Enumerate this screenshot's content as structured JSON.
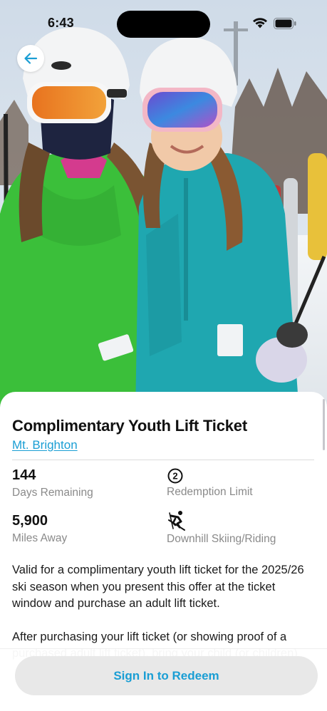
{
  "status_bar": {
    "time": "6:43"
  },
  "hero": {
    "image_subject": "two-skiers-photo"
  },
  "navigation": {
    "back_icon": "arrow-left-icon"
  },
  "offer": {
    "title": "Complimentary Youth Lift Ticket",
    "resort": "Mt. Brighton",
    "stats": [
      {
        "value": "144",
        "label": "Days Remaining"
      },
      {
        "icon": "redemption-count-icon",
        "icon_text": "2",
        "label": "Redemption Limit"
      },
      {
        "value": "5,900",
        "label": "Miles Away"
      },
      {
        "icon": "skier-icon",
        "label": "Downhill Skiing/Riding"
      }
    ],
    "description": [
      "Valid for a complimentary youth lift ticket for the 2025/26 ski season when you present this offer at the ticket window and purchase an adult lift ticket.",
      "After purchasing your lift ticket (or showing proof of a purchased adult lift ticket), bring your child (or children)"
    ]
  },
  "actions": {
    "redeem_label": "Sign In to Redeem"
  },
  "colors": {
    "accent": "#1a9ed4",
    "button_bg": "#e8e8e8",
    "muted_text": "#8a8a8a"
  }
}
